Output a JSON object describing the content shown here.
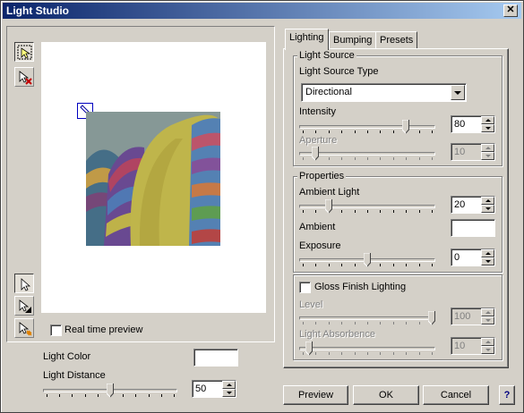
{
  "window": {
    "title": "Light Studio",
    "close_glyph": "✕"
  },
  "tools_top": [
    {
      "icon": "select-light-icon",
      "pressed": true
    },
    {
      "icon": "delete-light-icon",
      "pressed": false
    }
  ],
  "tools_bottom": [
    {
      "icon": "directional-light-tool-icon",
      "pressed": true
    },
    {
      "icon": "spot-light-tool-icon",
      "pressed": false
    },
    {
      "icon": "omni-light-tool-icon",
      "pressed": false
    }
  ],
  "preview": {
    "realtime_label": "Real time preview",
    "realtime_checked": false
  },
  "left_bottom": {
    "light_color_label": "Light Color",
    "light_distance_label": "Light Distance",
    "light_distance_value": "50",
    "light_distance_slider": 0.5
  },
  "tabs": [
    {
      "label": "Lighting",
      "active": true
    },
    {
      "label": "Bumping",
      "active": false
    },
    {
      "label": "Presets",
      "active": false
    }
  ],
  "light_source": {
    "group_label": "Light Source",
    "type_label": "Light Source Type",
    "type_value": "Directional",
    "intensity_label": "Intensity",
    "intensity_value": "80",
    "intensity_slider": 0.8,
    "aperture_label": "Aperture",
    "aperture_value": "10",
    "aperture_slider": 0.1
  },
  "properties": {
    "group_label": "Properties",
    "ambient_light_label": "Ambient Light",
    "ambient_light_value": "20",
    "ambient_light_slider": 0.2,
    "ambient_label": "Ambient",
    "exposure_label": "Exposure",
    "exposure_value": "0",
    "exposure_slider": 0.5
  },
  "gloss": {
    "checkbox_label": "Gloss Finish Lighting",
    "checked": false,
    "level_label": "Level",
    "level_value": "100",
    "level_slider": 1.0,
    "absorbence_label": "Light Absorbence",
    "absorbence_value": "10",
    "absorbence_slider": 0.05
  },
  "buttons": {
    "preview": "Preview",
    "ok": "OK",
    "cancel": "Cancel",
    "help": "?"
  },
  "colors": {
    "title_start": "#0a246a",
    "title_end": "#a6caf0",
    "face": "#d4d0c8"
  }
}
